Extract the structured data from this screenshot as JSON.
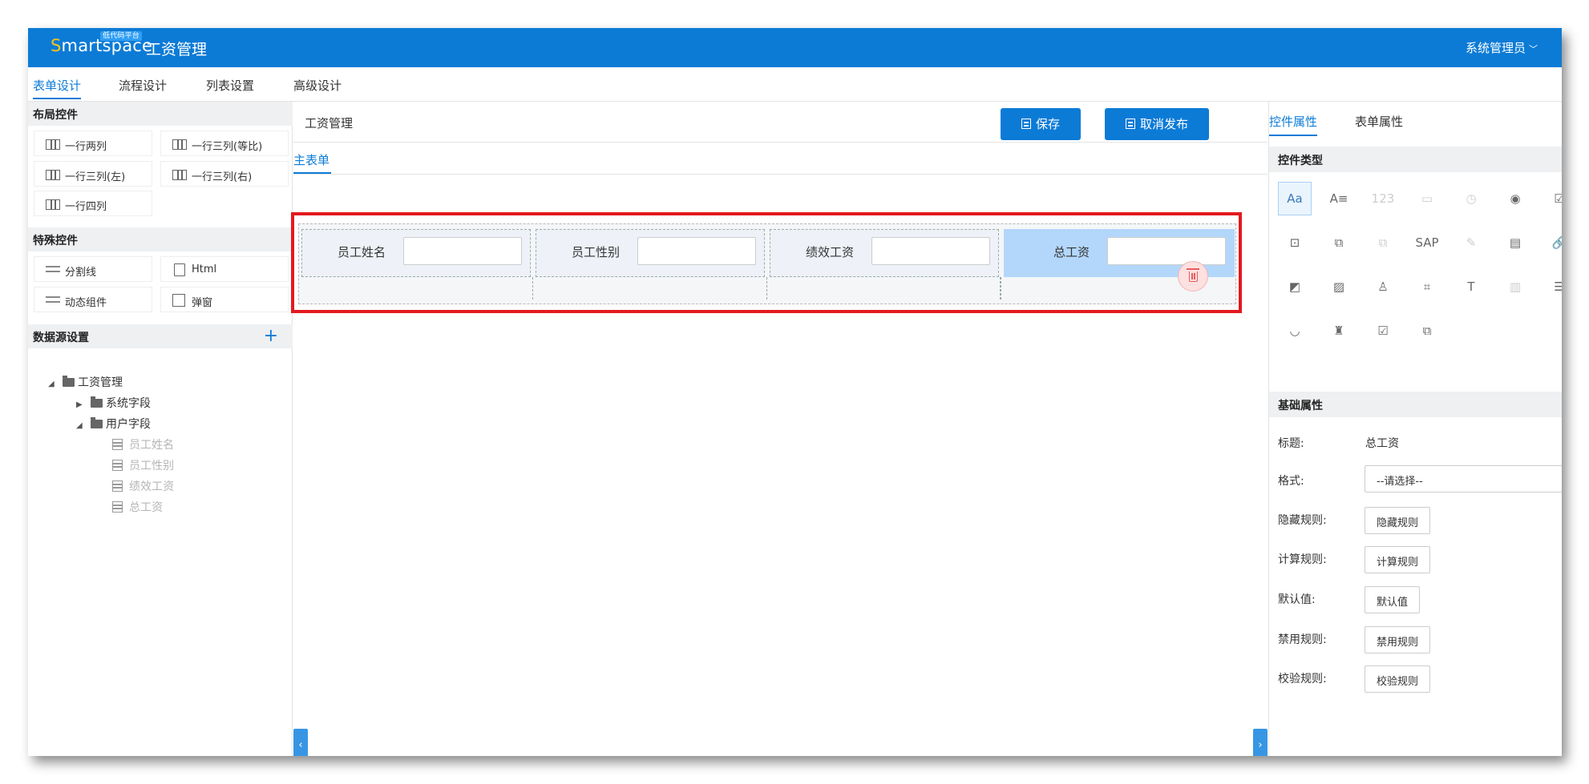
{
  "header": {
    "logo_prefix": "S",
    "logo_rest": "martspace",
    "logo_badge": "低代码平台",
    "app_title": "工资管理",
    "user": "系统管理员"
  },
  "tabs": [
    "表单设计",
    "流程设计",
    "列表设置",
    "高级设计"
  ],
  "left": {
    "layout_title": "布局控件",
    "layout_controls": [
      "一行两列",
      "一行三列(等比)",
      "一行三列(左)",
      "一行三列(右)",
      "一行四列"
    ],
    "special_title": "特殊控件",
    "special_controls": [
      "分割线",
      "Html",
      "动态组件",
      "弹窗"
    ],
    "datasource_title": "数据源设置",
    "datasource_add": "+",
    "tree": {
      "root": "工资管理",
      "children": [
        {
          "label": "系统字段"
        },
        {
          "label": "用户字段",
          "fields": [
            "员工姓名",
            "员工性别",
            "绩效工资",
            "总工资"
          ]
        }
      ]
    }
  },
  "center": {
    "form_title": "工资管理",
    "save_label": "保存",
    "unpublish_label": "取消发布",
    "subtab": "主表单",
    "fields": [
      {
        "label": "员工姓名",
        "value": ""
      },
      {
        "label": "员工性别",
        "value": ""
      },
      {
        "label": "绩效工资",
        "value": ""
      },
      {
        "label": "总工资",
        "value": ""
      }
    ],
    "left_toggle": "‹",
    "right_toggle": "›"
  },
  "right": {
    "tabs": [
      "控件属性",
      "表单属性"
    ],
    "type_title": "控件类型",
    "type_icons": [
      "text-icon",
      "textarea-icon",
      "number-icon",
      "date-icon",
      "time-icon",
      "radio-icon",
      "checkbox-icon",
      "select-icon",
      "multiselect-icon",
      "copy-icon",
      "sap-icon",
      "signature-icon",
      "document-icon",
      "attachment-icon",
      "file-icon",
      "image-icon",
      "user-icon",
      "org-icon",
      "label-icon",
      "barcode-icon",
      "list-icon",
      "eye-icon",
      "stamp-icon",
      "approve-icon",
      "subform-icon"
    ],
    "type_icon_glyphs": [
      "Aa",
      "A≡",
      "123",
      "▭",
      "◷",
      "◉",
      "☑",
      "⊡",
      "⧉",
      "⧉",
      "SAP",
      "✎",
      "▤",
      "🔗",
      "◩",
      "▨",
      "♙",
      "⌗",
      "T",
      "▥",
      "☰",
      "◡",
      "♜",
      "☑",
      "⧉"
    ],
    "basic_title": "基础属性",
    "props": {
      "title_label": "标题:",
      "title_value": "总工资",
      "format_label": "格式:",
      "format_value": "--请选择--",
      "hide_label": "隐藏规则:",
      "hide_btn": "隐藏规则",
      "calc_label": "计算规则:",
      "calc_btn": "计算规则",
      "default_label": "默认值:",
      "default_btn": "默认值",
      "disable_label": "禁用规则:",
      "disable_btn": "禁用规则",
      "validate_label": "校验规则:",
      "validate_btn": "校验规则"
    }
  }
}
